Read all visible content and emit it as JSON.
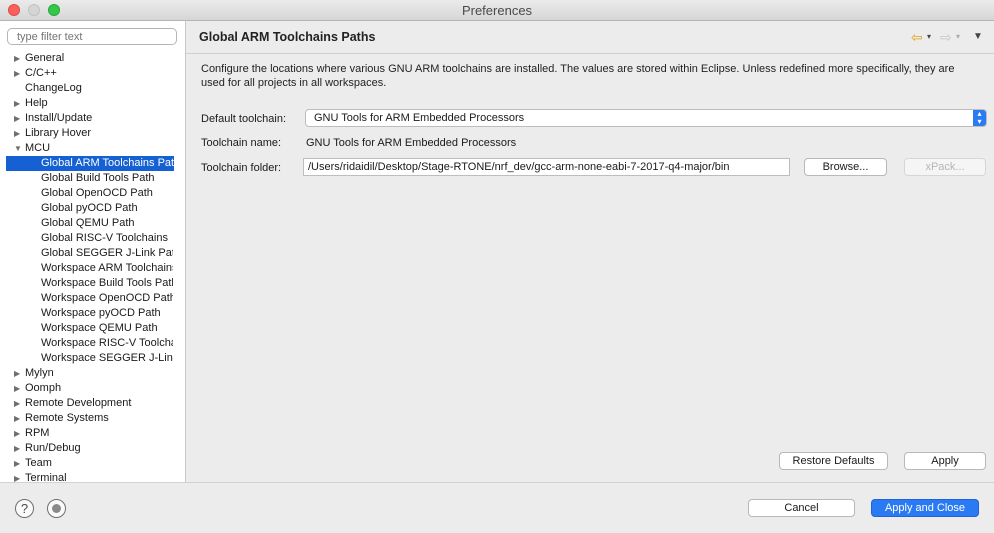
{
  "window": {
    "title": "Preferences"
  },
  "sidebar": {
    "filter_placeholder": "type filter text",
    "items": [
      {
        "label": "General",
        "twisty": "collapsed"
      },
      {
        "label": "C/C++",
        "twisty": "collapsed"
      },
      {
        "label": "ChangeLog",
        "twisty": "none"
      },
      {
        "label": "Help",
        "twisty": "collapsed"
      },
      {
        "label": "Install/Update",
        "twisty": "collapsed"
      },
      {
        "label": "Library Hover",
        "twisty": "collapsed"
      },
      {
        "label": "MCU",
        "twisty": "expanded"
      },
      {
        "label": "Global ARM Toolchains Paths",
        "child": true,
        "selected": true
      },
      {
        "label": "Global Build Tools Path",
        "child": true
      },
      {
        "label": "Global OpenOCD Path",
        "child": true
      },
      {
        "label": "Global pyOCD Path",
        "child": true
      },
      {
        "label": "Global QEMU Path",
        "child": true
      },
      {
        "label": "Global RISC-V Toolchains",
        "child": true
      },
      {
        "label": "Global SEGGER J-Link Path",
        "child": true
      },
      {
        "label": "Workspace ARM Toolchains",
        "child": true
      },
      {
        "label": "Workspace Build Tools Path",
        "child": true
      },
      {
        "label": "Workspace OpenOCD Path",
        "child": true
      },
      {
        "label": "Workspace pyOCD Path",
        "child": true
      },
      {
        "label": "Workspace QEMU Path",
        "child": true
      },
      {
        "label": "Workspace RISC-V Toolchains",
        "child": true
      },
      {
        "label": "Workspace SEGGER J-Link",
        "child": true
      },
      {
        "label": "Mylyn",
        "twisty": "collapsed"
      },
      {
        "label": "Oomph",
        "twisty": "collapsed"
      },
      {
        "label": "Remote Development",
        "twisty": "collapsed"
      },
      {
        "label": "Remote Systems",
        "twisty": "collapsed"
      },
      {
        "label": "RPM",
        "twisty": "collapsed"
      },
      {
        "label": "Run/Debug",
        "twisty": "collapsed"
      },
      {
        "label": "Team",
        "twisty": "collapsed"
      },
      {
        "label": "Terminal",
        "twisty": "collapsed"
      }
    ]
  },
  "page": {
    "title": "Global ARM Toolchains Paths",
    "description": "Configure the locations where various GNU ARM toolchains are installed. The values are stored within Eclipse. Unless redefined more specifically, they are used for all projects in all workspaces.",
    "default_toolchain_label": "Default toolchain:",
    "default_toolchain_value": "GNU Tools for ARM Embedded Processors",
    "toolchain_name_label": "Toolchain name:",
    "toolchain_name_value": "GNU Tools for ARM Embedded Processors",
    "toolchain_folder_label": "Toolchain folder:",
    "toolchain_folder_value": "/Users/ridaidil/Desktop/Stage-RTONE/nrf_dev/gcc-arm-none-eabi-7-2017-q4-major/bin",
    "browse_label": "Browse...",
    "xpack_label": "xPack...",
    "restore_defaults_label": "Restore Defaults",
    "apply_label": "Apply"
  },
  "footer": {
    "cancel_label": "Cancel",
    "apply_close_label": "Apply and Close"
  },
  "colors": {
    "accent": "#2a7bf3",
    "selection": "#1560d3",
    "back_arrow": "#e3a21a"
  },
  "icons": [
    "back-arrow-icon",
    "forward-arrow-icon",
    "view-menu-icon",
    "help-icon",
    "record-icon"
  ]
}
